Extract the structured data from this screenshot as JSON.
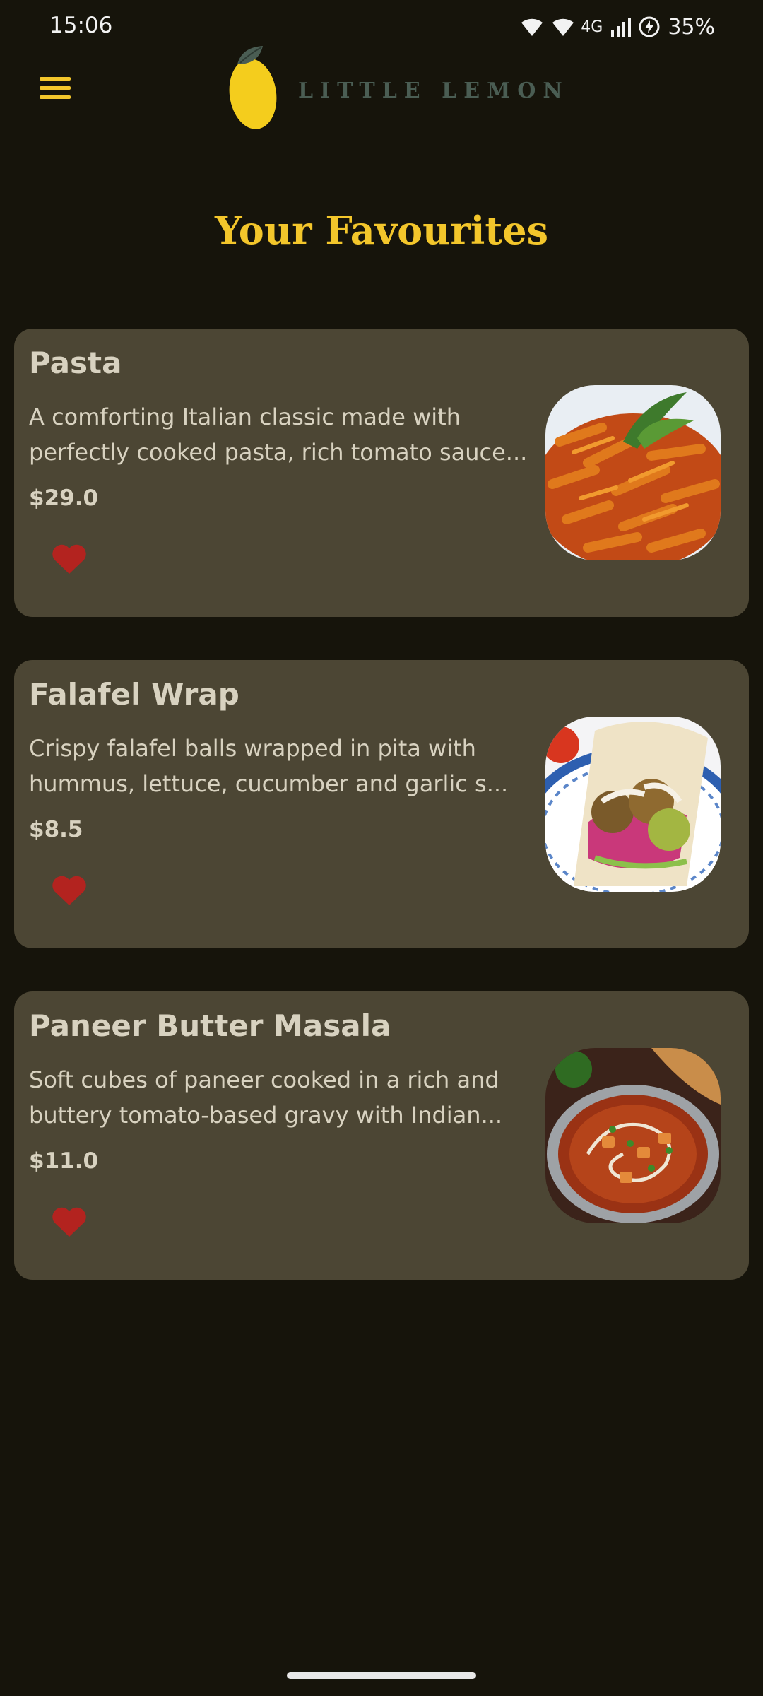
{
  "status_bar": {
    "time": "15:06",
    "network": "4G",
    "battery": "35%"
  },
  "header": {
    "menu_icon": "hamburger-menu-icon",
    "logo_icon": "lemon-icon",
    "logo_text": "LITTLE LEMON"
  },
  "page": {
    "title": "Your Favourites"
  },
  "favourites": [
    {
      "name": "Pasta",
      "description_line1": "A comforting Italian classic made with",
      "description_line2": "perfectly cooked pasta, rich tomato sauce...",
      "price": "$29.0",
      "image": "pasta-photo"
    },
    {
      "name": "Falafel Wrap",
      "description_line1": "Crispy falafel balls wrapped in pita with",
      "description_line2": "hummus, lettuce, cucumber and garlic s...",
      "price": "$8.5",
      "image": "falafel-wrap-photo"
    },
    {
      "name": "Paneer Butter Masala",
      "description_line1": "Soft cubes of paneer cooked in a rich and",
      "description_line2": "buttery tomato-based gravy with Indian...",
      "price": "$11.0",
      "image": "paneer-butter-masala-photo"
    }
  ],
  "colors": {
    "background": "#16140b",
    "card": "#4c4634",
    "accent_yellow": "#f3c62b",
    "logo_green": "#4a5d53",
    "heart_red": "#b3231f",
    "text": "#d8d2c0"
  }
}
